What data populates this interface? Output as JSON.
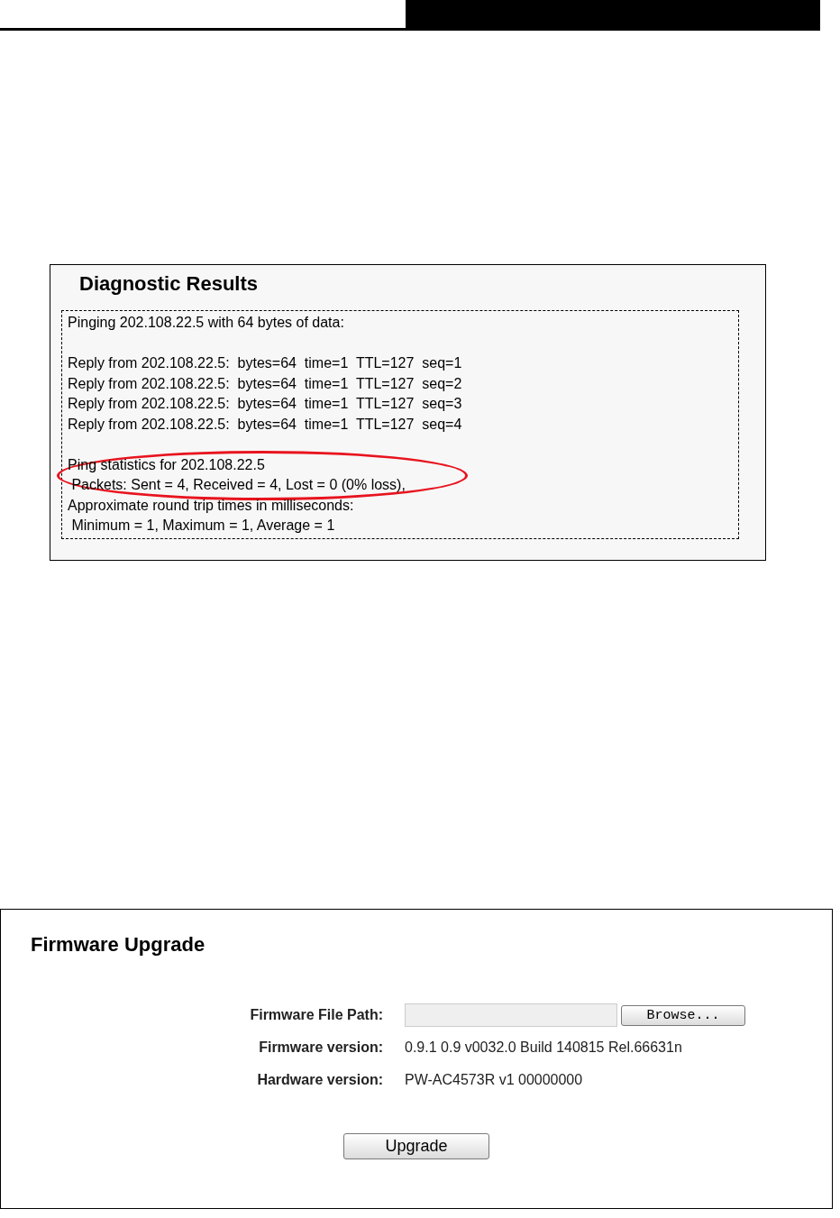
{
  "diagnostic": {
    "title": "Diagnostic Results",
    "intro": "Pinging 202.108.22.5 with 64 bytes of data:",
    "replies": [
      "Reply from 202.108.22.5:  bytes=64  time=1  TTL=127  seq=1",
      "Reply from 202.108.22.5:  bytes=64  time=1  TTL=127  seq=2",
      "Reply from 202.108.22.5:  bytes=64  time=1  TTL=127  seq=3",
      "Reply from 202.108.22.5:  bytes=64  time=1  TTL=127  seq=4"
    ],
    "statistics": [
      {
        "text": "Ping statistics for 202.108.22.5",
        "highlighted": true
      },
      {
        "text": " Packets: Sent = 4, Received = 4, Lost = 0 (0% loss),",
        "highlighted": true
      },
      {
        "text": "Approximate round trip times in milliseconds:",
        "highlighted": false
      },
      {
        "text": " Minimum = 1, Maximum = 1, Average = 1",
        "highlighted": false
      }
    ]
  },
  "firmware": {
    "title": "Firmware Upgrade",
    "rows": [
      {
        "kind": "file",
        "label": "Firmware File Path:",
        "button": "Browse..."
      },
      {
        "kind": "text",
        "label": "Firmware version:",
        "value": "0.9.1 0.9 v0032.0 Build 140815 Rel.66631n"
      },
      {
        "kind": "text",
        "label": "Hardware version:",
        "value": "PW-AC4573R v1 00000000"
      }
    ],
    "action": "Upgrade"
  }
}
